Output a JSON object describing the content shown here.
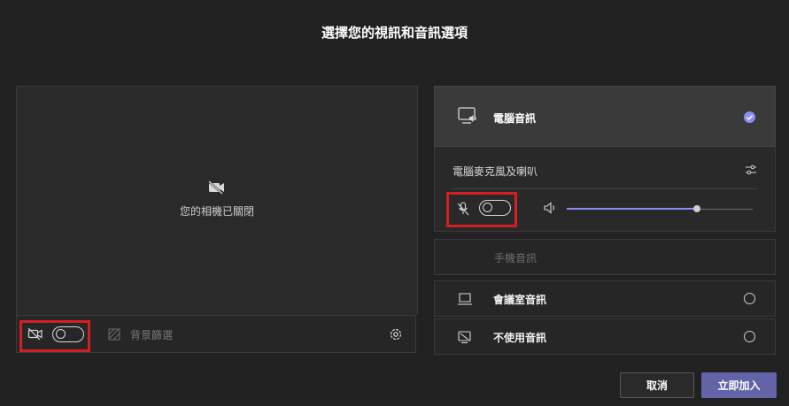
{
  "dialog": {
    "title": "選擇您的視訊和音訊選項"
  },
  "video": {
    "camera_off_text": "您的相機已關閉",
    "camera_toggle_on": false,
    "background_filter_label": "背景篩選"
  },
  "audio": {
    "computer_audio_label": "電腦音訊",
    "computer_audio_selected": true,
    "device_label": "電腦麥克風及喇叭",
    "mic_toggle_on": false,
    "speaker_volume": 0.7,
    "phone_audio_label": "手機音訊",
    "room_audio_label": "會議室音訊",
    "no_audio_label": "不使用音訊"
  },
  "actions": {
    "cancel_label": "取消",
    "join_label": "立即加入"
  },
  "colors": {
    "accent": "#6264a7",
    "highlight": "#d21f24",
    "check": "#8b8cf8"
  },
  "icons": [
    "camera-off-icon",
    "background-effects-icon",
    "settings-icon",
    "computer-audio-icon",
    "checkmark-icon",
    "device-settings-icon",
    "mic-off-icon",
    "speaker-icon",
    "room-audio-icon",
    "no-audio-icon"
  ]
}
